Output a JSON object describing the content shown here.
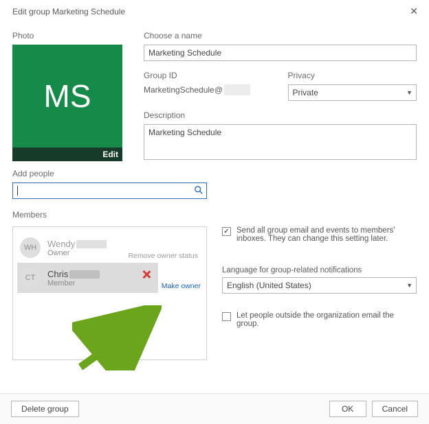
{
  "title": "Edit group Marketing Schedule",
  "photo": {
    "label": "Photo",
    "initials": "MS",
    "edit": "Edit"
  },
  "name": {
    "label": "Choose a name",
    "value": "Marketing Schedule"
  },
  "groupId": {
    "label": "Group ID",
    "prefix": "MarketingSchedule@"
  },
  "privacy": {
    "label": "Privacy",
    "value": "Private"
  },
  "description": {
    "label": "Description",
    "value": "Marketing Schedule"
  },
  "addPeople": {
    "label": "Add people"
  },
  "members": {
    "label": "Members",
    "list": [
      {
        "initials": "WH",
        "name": "Wendy",
        "role": "Owner",
        "action": "Remove owner status"
      },
      {
        "initials": "CT",
        "name": "Chris",
        "role": "Member",
        "action": "Make owner"
      }
    ]
  },
  "sendEmail": {
    "checked": true,
    "text": "Send all group email and events to members' inboxes. They can change this setting later."
  },
  "language": {
    "label": "Language for group-related notifications",
    "value": "English (United States)"
  },
  "allowExternal": {
    "checked": false,
    "text": "Let people outside the organization email the group."
  },
  "footer": {
    "delete": "Delete group",
    "ok": "OK",
    "cancel": "Cancel"
  }
}
